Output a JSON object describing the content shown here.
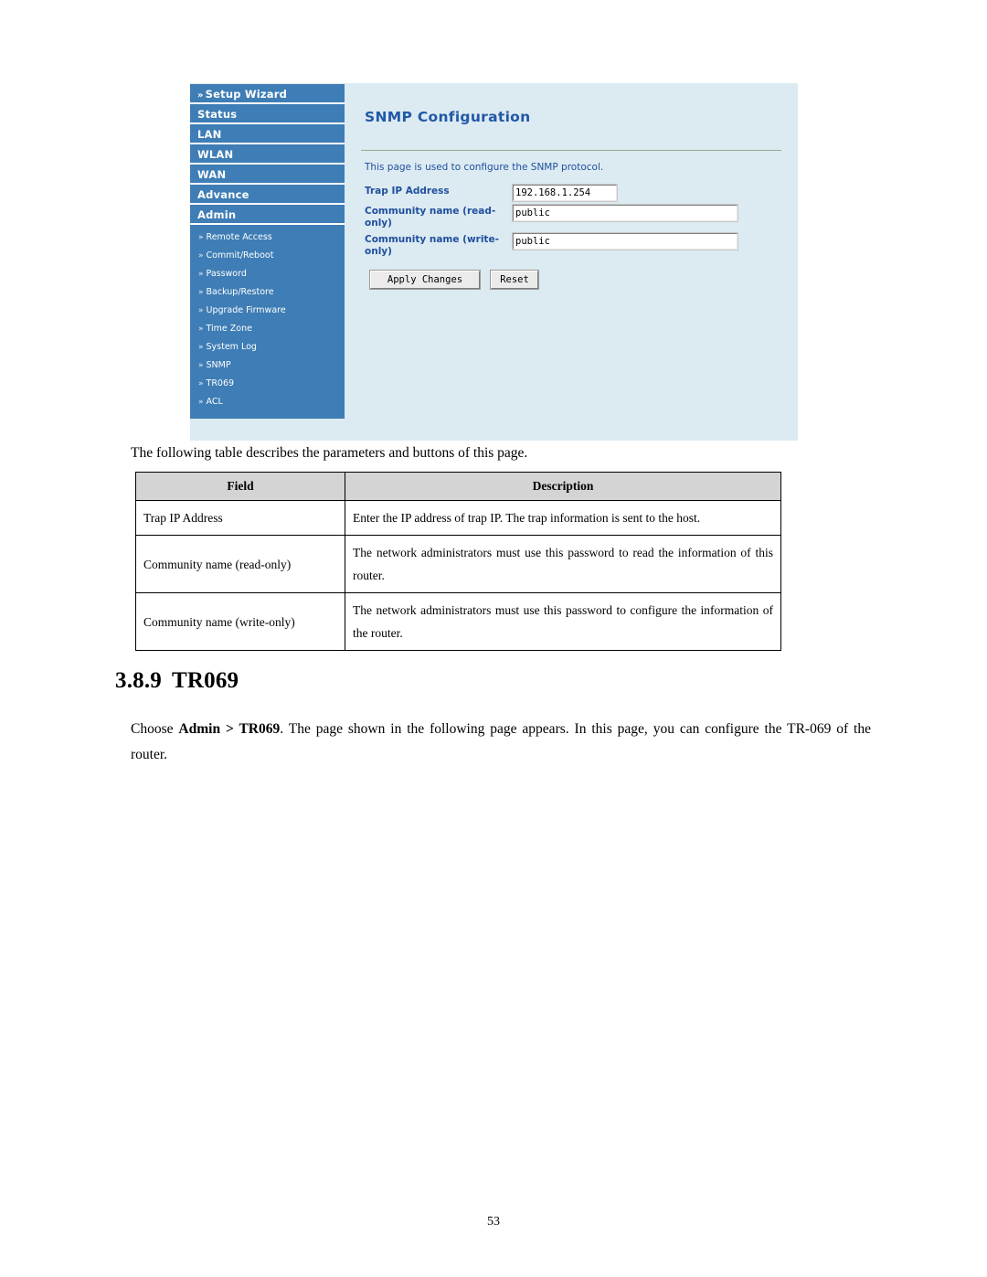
{
  "router_ui": {
    "sidebar": {
      "main_items": [
        {
          "label": "Setup Wizard",
          "has_chevron": true,
          "icon": "chevron-double-right-icon"
        },
        {
          "label": "Status",
          "has_chevron": false
        },
        {
          "label": "LAN",
          "has_chevron": false
        },
        {
          "label": "WLAN",
          "has_chevron": false
        },
        {
          "label": "WAN",
          "has_chevron": false
        },
        {
          "label": "Advance",
          "has_chevron": false
        },
        {
          "label": "Admin",
          "has_chevron": false
        }
      ],
      "sub_items": [
        {
          "label": "Remote Access"
        },
        {
          "label": "Commit/Reboot"
        },
        {
          "label": "Password"
        },
        {
          "label": "Backup/Restore"
        },
        {
          "label": "Upgrade Firmware"
        },
        {
          "label": "Time Zone"
        },
        {
          "label": "System Log"
        },
        {
          "label": "SNMP"
        },
        {
          "label": "TR069"
        },
        {
          "label": "ACL"
        }
      ],
      "chevron_glyph": "»",
      "background_color": "#3e7db5"
    },
    "content": {
      "title": "SNMP Configuration",
      "description": "This page is used to configure the SNMP protocol.",
      "title_color": "#2158a8",
      "panel_background": "#dceaf1",
      "fields": [
        {
          "label": "Trap IP Address",
          "value": "192.168.1.254"
        },
        {
          "label": "Community name (read-only)",
          "value": "public"
        },
        {
          "label": "Community name (write-only)",
          "value": "public"
        }
      ],
      "buttons": {
        "apply": "Apply Changes",
        "reset": "Reset"
      }
    }
  },
  "document": {
    "intro_text": "The following table describes the parameters and buttons of this page.",
    "table": {
      "headers": [
        "Field",
        "Description"
      ],
      "rows": [
        {
          "field": "Trap IP Address",
          "description": "Enter the IP address of trap IP. The trap information is sent to the host."
        },
        {
          "field": "Community name (read-only)",
          "description": "The network administrators must use this password to read the information of this router."
        },
        {
          "field": "Community name (write-only)",
          "description": "The network administrators must use this password to configure the information of the router."
        }
      ]
    },
    "section": {
      "number": "3.8.9",
      "title": "TR069"
    },
    "paragraph": {
      "lead": "Choose ",
      "bold1": "Admin",
      "mid": " > ",
      "bold2": "TR069",
      "rest": ". The page shown in the following page appears. In this page, you can configure the TR-069 of the router."
    },
    "page_number": "53"
  }
}
